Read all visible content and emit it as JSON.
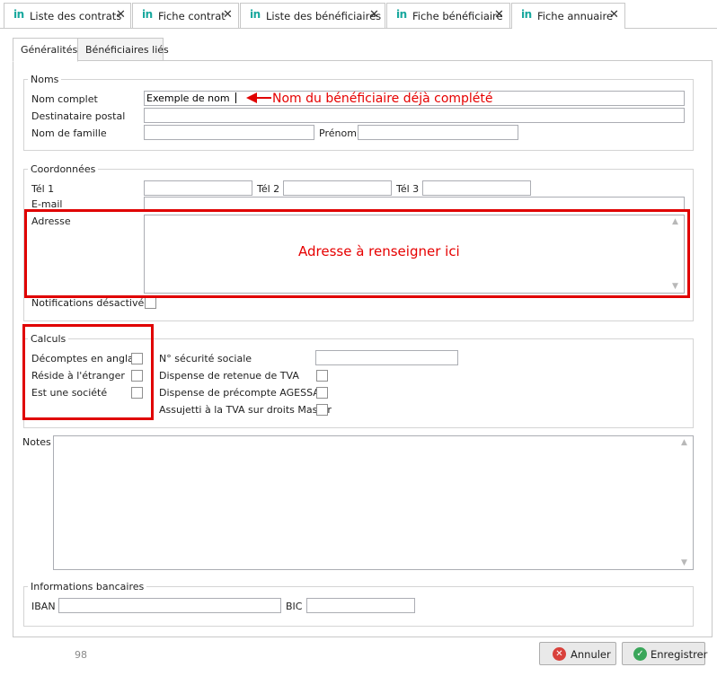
{
  "document_tabs": [
    {
      "label": "Liste des contrats",
      "icon": "in"
    },
    {
      "label": "Fiche contrat",
      "icon": "in"
    },
    {
      "label": "Liste des bénéficiaires",
      "icon": "in"
    },
    {
      "label": "Fiche bénéficiaire",
      "icon": "in"
    },
    {
      "label": "Fiche annuaire",
      "icon": "in",
      "active": true
    }
  ],
  "page_tabs": [
    {
      "label": "Généralités",
      "active": true
    },
    {
      "label": "Bénéficiaires liés"
    }
  ],
  "noms": {
    "title": "Noms",
    "nom_complet_label": "Nom complet",
    "nom_complet_value": "Exemple de nom",
    "destinataire_label": "Destinataire postal",
    "destinataire_value": "",
    "nom_famille_label": "Nom de famille",
    "nom_famille_value": "",
    "prenom_label": "Prénom",
    "prenom_value": ""
  },
  "coordonnees": {
    "title": "Coordonnées",
    "tel1_label": "Tél 1",
    "tel2_label": "Tél 2",
    "tel3_label": "Tél 3",
    "email_label": "E-mail",
    "adresse_label": "Adresse",
    "notifications_label": "Notifications désactivées",
    "notifications_checked": false
  },
  "calculs": {
    "title": "Calculs",
    "left": [
      {
        "label": "Décomptes en anglais",
        "checked": false
      },
      {
        "label": "Réside à l'étranger",
        "checked": false
      },
      {
        "label": "Est une société",
        "checked": false
      }
    ],
    "secu_label": "N° sécurité sociale",
    "secu_value": "",
    "right": [
      {
        "label": "Dispense de retenue de TVA",
        "checked": false
      },
      {
        "label": "Dispense de précompte AGESSA",
        "checked": false
      },
      {
        "label": "Assujetti à la TVA sur droits Master",
        "checked": false
      }
    ]
  },
  "notes": {
    "label": "Notes"
  },
  "banque": {
    "title": "Informations bancaires",
    "iban_label": "IBAN",
    "bic_label": "BIC"
  },
  "footer": {
    "record_id": "98",
    "cancel_label": "Annuler",
    "save_label": "Enregistrer"
  },
  "annotations": {
    "nom_arrow_text": "Nom du bénéficiaire déjà complété",
    "adresse_text": "Adresse à renseigner ici"
  },
  "colors": {
    "annotation_red": "#e00000",
    "brand_teal": "#18a89e",
    "cancel_red": "#d9413b",
    "save_green": "#3aa65a"
  }
}
